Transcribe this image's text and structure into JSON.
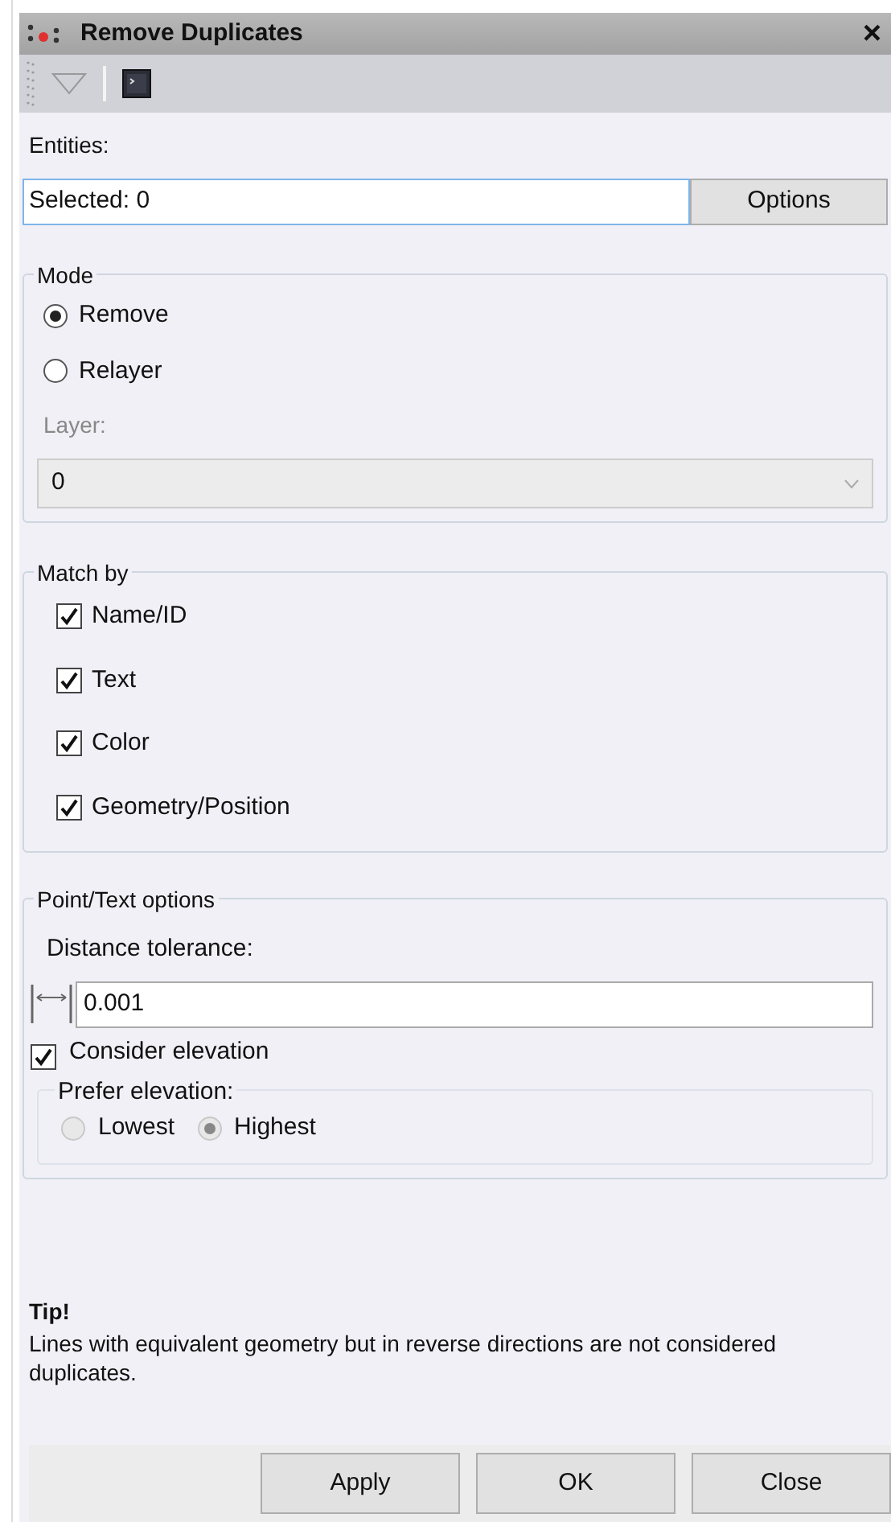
{
  "window": {
    "title": "Remove Duplicates",
    "close": "×"
  },
  "entities": {
    "label": "Entities:",
    "value": "Selected: 0",
    "button": "Options"
  },
  "mode": {
    "title": "Mode",
    "options": [
      {
        "label": "Remove",
        "selected": true
      },
      {
        "label": "Relayer",
        "selected": false
      }
    ],
    "layer_label": "Layer:",
    "layer_value": "0",
    "layer_disabled": true
  },
  "match_by": {
    "title": "Match by",
    "items": [
      {
        "label": "Name/ID",
        "checked": true
      },
      {
        "label": "Text",
        "checked": true
      },
      {
        "label": "Color",
        "checked": true
      },
      {
        "label": "Geometry/Position",
        "checked": true
      }
    ]
  },
  "point_text": {
    "title": "Point/Text options",
    "tolerance_label": "Distance tolerance:",
    "tolerance_value": "0.001",
    "consider_elevation": {
      "label": "Consider elevation",
      "checked": true
    },
    "prefer": {
      "title": "Prefer elevation:",
      "disabled": true,
      "options": [
        {
          "label": "Lowest",
          "selected": false
        },
        {
          "label": "Highest",
          "selected": true
        }
      ]
    }
  },
  "tip": {
    "title": "Tip!",
    "text": "Lines with equivalent geometry but in reverse directions are not considered duplicates."
  },
  "buttons": [
    "Apply",
    "OK",
    "Close"
  ]
}
